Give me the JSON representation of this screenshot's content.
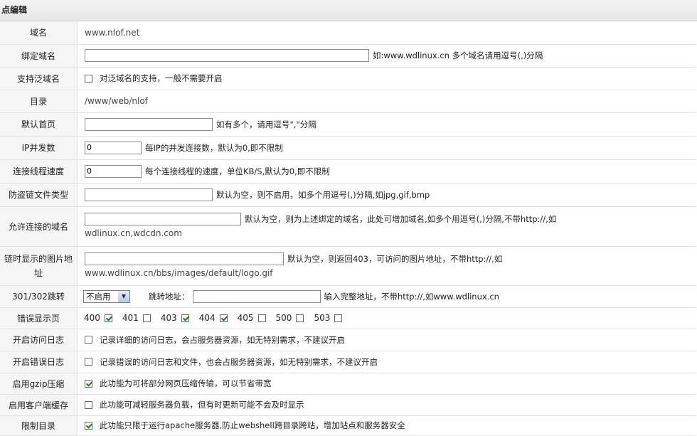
{
  "header": {
    "title": "点编辑"
  },
  "rows": {
    "domain": {
      "label": "域名",
      "value": "www.nlof.net"
    },
    "bind": {
      "label": "绑定域名",
      "value": "",
      "note": "如:www.wdlinux.cn 多个域名请用逗号(,)分隔"
    },
    "wildcard": {
      "label": "支持泛域名",
      "checked": false,
      "note": "对泛域名的支持，一般不需要开启"
    },
    "dir": {
      "label": "目录",
      "value": "/www/web/nlof"
    },
    "index": {
      "label": "默认首页",
      "value": "",
      "note": "如有多个，请用逗号\",\"分隔"
    },
    "ipconn": {
      "label": "IP并发数",
      "value": "0",
      "note": "每IP的并发连接数，默认为0,即不限制"
    },
    "speed": {
      "label": "连接线程速度",
      "value": "0",
      "note": "每个连接线程的速度，单位KB/S,默认为0,即不限制"
    },
    "hotlink_types": {
      "label": "防盗链文件类型",
      "value": "",
      "note": "默认为空，则不启用，如多个用逗号(,)分隔,如jpg,gif,bmp"
    },
    "allowed_domains": {
      "label": "允许连接的域名",
      "value": "",
      "note": "默认为空，则为上述绑定的域名，此处可增加域名,如多个用逗号(,)分隔,不带http://,如",
      "note2": "wdlinux.cn,wdcdn.com"
    },
    "hotlink_image": {
      "label1": "链时显示的图片地",
      "label2": "址",
      "value": "",
      "note": "默认为空，则返回403，可访问的图片地址，不带http://,如",
      "note2": "www.wdlinux.cn/bbs/images/default/logo.gif"
    },
    "redirect": {
      "label": "301/302跳转",
      "select_value": "不启用",
      "addr_label": "跳转地址：",
      "value": "",
      "note": "输入完整地址，不带http://,如www.wdlinux.cn"
    },
    "errors": {
      "label": "错误显示页",
      "codes": [
        {
          "code": "400",
          "checked": true
        },
        {
          "code": "401",
          "checked": false
        },
        {
          "code": "403",
          "checked": true
        },
        {
          "code": "404",
          "checked": true
        },
        {
          "code": "405",
          "checked": false
        },
        {
          "code": "500",
          "checked": false
        },
        {
          "code": "503",
          "checked": false
        }
      ]
    },
    "access_log": {
      "label": "开启访问日志",
      "checked": false,
      "note": "记录详细的访问日志，会占服务器资源，如无特别需求，不建议开启"
    },
    "error_log": {
      "label": "开启错误日志",
      "checked": false,
      "note": "记录错误的访问日志和文件，也会占服务器资源，如无特别需求，不建议开启"
    },
    "gzip": {
      "label": "启用gzip压缩",
      "checked": true,
      "note": "此功能为可将部分网页压缩传输，可以节省带宽"
    },
    "client_cache": {
      "label": "启用客户端缓存",
      "checked": false,
      "note": "此功能可减轻服务器负载，但有时更新可能不会及时显示"
    },
    "limit_dir": {
      "label": "限制目录",
      "checked": true,
      "note": "此功能只限于运行apache服务器,防止webshell跨目录跨站，增加站点和服务器安全"
    }
  }
}
